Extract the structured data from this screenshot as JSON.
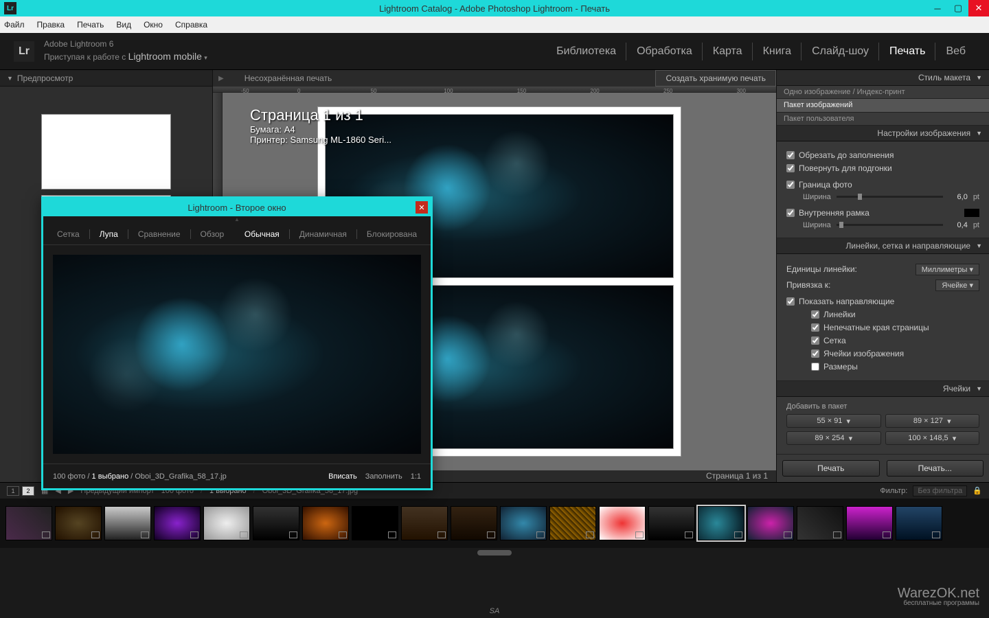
{
  "titlebar": {
    "icon": "Lr",
    "text": "Lightroom Catalog - Adobe Photoshop Lightroom - Печать"
  },
  "menubar": [
    "Файл",
    "Правка",
    "Печать",
    "Вид",
    "Окно",
    "Справка"
  ],
  "header": {
    "logo": "Lr",
    "line1": "Adobe Lightroom 6",
    "line2_a": "Приступая к работе с ",
    "line2_b": "Lightroom mobile"
  },
  "modules": [
    "Библиотека",
    "Обработка",
    "Карта",
    "Книга",
    "Слайд-шоу",
    "Печать",
    "Веб"
  ],
  "active_module": "Печать",
  "leftpanel": {
    "title": "Предпросмотр"
  },
  "center": {
    "unsaved": "Несохранённая печать",
    "create_btn": "Создать хранимую печать",
    "ruler_ticks": [
      "-50",
      "0",
      "50",
      "100",
      "150",
      "200",
      "250",
      "300"
    ],
    "page_info": {
      "title": "Страница 1 из 1",
      "paper_label": "Бумага:",
      "paper": "A4",
      "printer_label": "Принтер:",
      "printer": "Samsung ML-1860 Seri..."
    },
    "footer": "Страница 1 из 1"
  },
  "rightpanel": {
    "layout_style": {
      "title": "Стиль макета",
      "items": [
        "Одно изображение / Индекс-принт",
        "Пакет изображений",
        "Пакет пользователя"
      ],
      "selected": 1
    },
    "image_settings": {
      "title": "Настройки изображения",
      "crop_to_fill": "Обрезать до заполнения",
      "rotate_to_fit": "Повернуть для подгонки",
      "photo_border": "Граница фото",
      "width_label": "Ширина",
      "border_val": "6,0",
      "border_unit": "pt",
      "inner_frame": "Внутренняя рамка",
      "inner_val": "0,4",
      "inner_unit": "pt"
    },
    "rulers": {
      "title": "Линейки, сетка и направляющие",
      "ruler_units_label": "Единицы линейки:",
      "ruler_units": "Миллиметры",
      "snap_label": "Привязка к:",
      "snap": "Ячейке",
      "show_guides": "Показать направляющие",
      "sub": [
        "Линейки",
        "Непечатные края страницы",
        "Сетка",
        "Ячейки изображения",
        "Размеры"
      ]
    },
    "cells": {
      "title": "Ячейки",
      "add_label": "Добавить в пакет",
      "btns": [
        "55 × 91",
        "89 × 127",
        "89 × 254",
        "100 × 148,5"
      ]
    },
    "print_buttons": [
      "Печать",
      "Печать..."
    ]
  },
  "stripbar": {
    "mon1": "1",
    "mon2": "2",
    "prev_import": "Предыдущий импорт",
    "count": "100 фото",
    "selected": "1 выбрано",
    "filename": "Oboi_3D_Grafika_58_17.jpg",
    "filter_label": "Фильтр:",
    "filter_value": "Без фильтра"
  },
  "filmstrip": {
    "thumbs": 19,
    "selected_index": 14
  },
  "secwin": {
    "title": "Lightroom - Второе окно",
    "tabs": [
      "Сетка",
      "Лупа",
      "Сравнение",
      "Обзор",
      "Обычная",
      "Динамичная",
      "Блокирована"
    ],
    "active_tab_a": "Лупа",
    "active_tab_b": "Обычная",
    "foot_count": "100 фото",
    "foot_sel": "1 выбрано",
    "foot_file": "Oboi_3D_Grafika_58_17.jp",
    "foot_right": [
      "Вписать",
      "Заполнить",
      "1:1"
    ]
  },
  "watermark": {
    "main": "WarezOK.net",
    "sub": "бесплатные программы"
  },
  "footer_text": "SA"
}
